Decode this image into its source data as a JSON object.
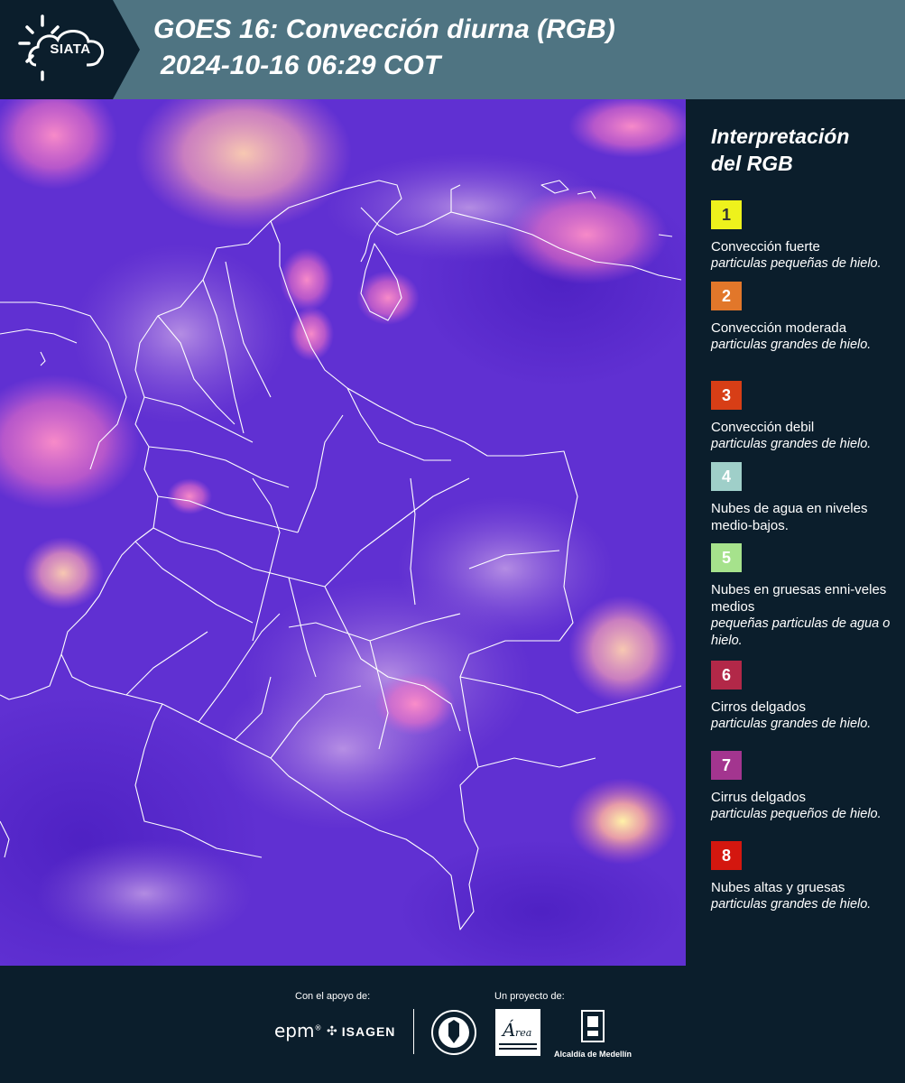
{
  "header": {
    "logo_text": "SIATA",
    "title_line1": "GOES 16: Convección diurna (RGB)",
    "title_line2": "2024-10-16 06:29 COT"
  },
  "map": {
    "description_icon": "satellite-rgb-map",
    "base_color": "#5d2ad0"
  },
  "legend": {
    "title_line1": "Interpretación",
    "title_line2": "del RGB",
    "items": [
      {
        "number": "1",
        "color": "#eef21c",
        "text_color": "#333333",
        "title": "Convección fuerte",
        "desc": "particulas pequeñas de hielo."
      },
      {
        "number": "2",
        "color": "#e2772a",
        "text_color": "#ffffff",
        "title": "Convección moderada",
        "desc": "particulas grandes de hielo."
      },
      {
        "number": "3",
        "color": "#d73e16",
        "text_color": "#ffffff",
        "title": "Convección debil",
        "desc": "particulas grandes de hielo."
      },
      {
        "number": "4",
        "color": "#9fcfc9",
        "text_color": "#ffffff",
        "title": "Nubes de agua en niveles medio-bajos.",
        "desc": ""
      },
      {
        "number": "5",
        "color": "#a6e28c",
        "text_color": "#ffffff",
        "title": "Nubes en gruesas enni-veles medios",
        "desc": "pequeñas particulas de agua o hielo."
      },
      {
        "number": "6",
        "color": "#b22848",
        "text_color": "#ffffff",
        "title": "Cirros delgados",
        "desc": "particulas grandes de hielo."
      },
      {
        "number": "7",
        "color": "#a3358f",
        "text_color": "#ffffff",
        "title": "Cirrus delgados",
        "desc": "particulas pequeños de hielo."
      },
      {
        "number": "8",
        "color": "#d4170f",
        "text_color": "#ffffff",
        "title": "Nubes altas y gruesas",
        "desc": "particulas grandes de hielo."
      }
    ]
  },
  "footer": {
    "support_label": "Con el apoyo de:",
    "project_label": "Un proyecto de:",
    "epm_text": "epm",
    "isagen_text": "ISAGEN",
    "alcaldia_text": "Alcaldía de Medellín"
  }
}
